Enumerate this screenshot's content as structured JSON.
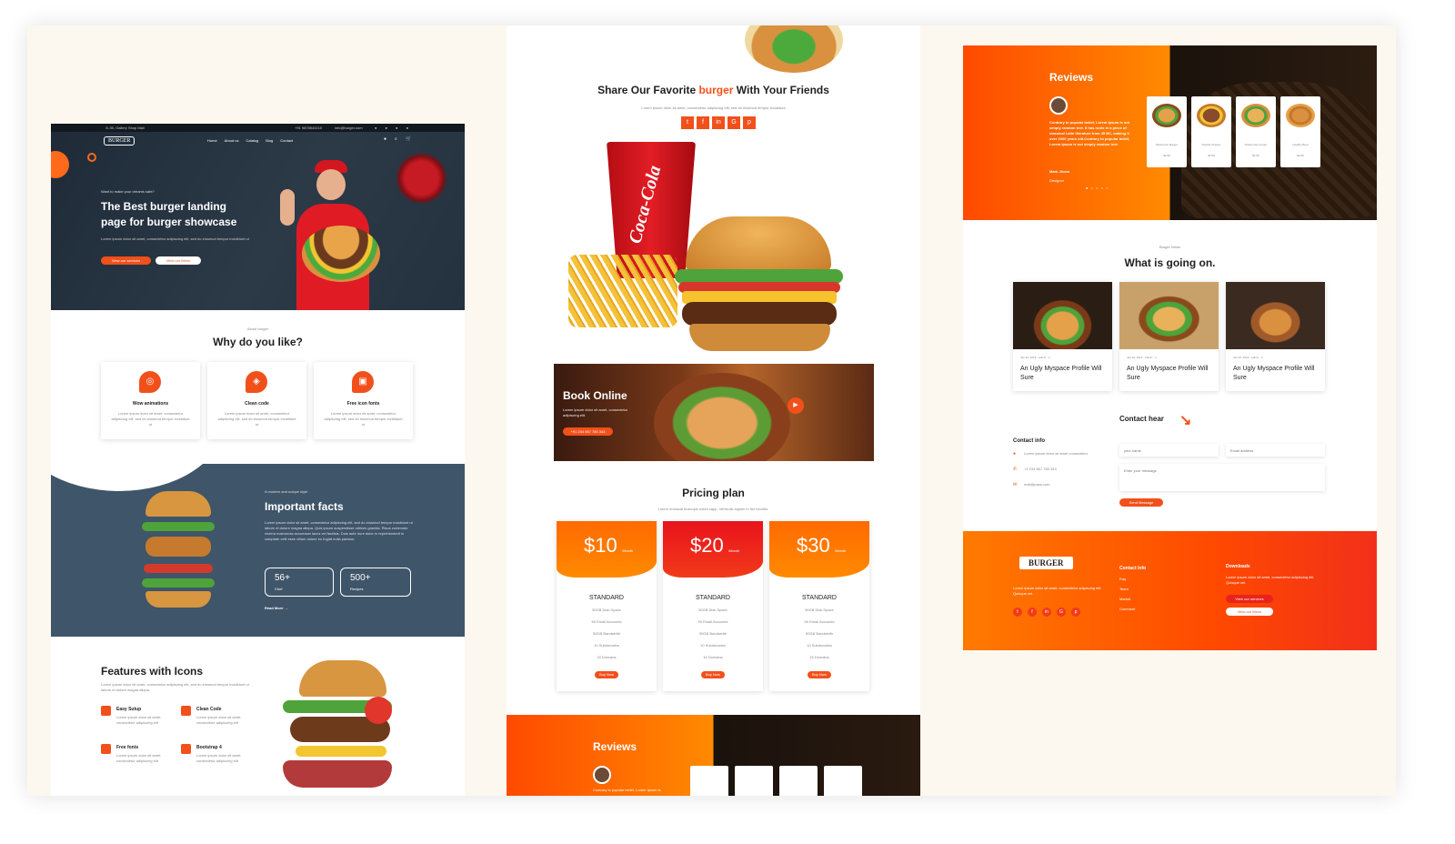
{
  "c1": {
    "topbar": {
      "address": "G-35, Gallery Shop Mall",
      "phone": "+91 9876543210",
      "email": "info@burger.com"
    },
    "logo": "BURGER",
    "nav": [
      "Home",
      "About us",
      "Catalog",
      "Blog",
      "Contact"
    ],
    "hero": {
      "eyebrow": "Want to make your dreams safe?",
      "title_line1": "The Best burger landing",
      "title_line2": "page for burger showcase",
      "text": "Lorem ipsum dolor sit amet, consectetur adipiscing elit, sed do eiusmod tempor incididunt ut",
      "btn1": "View our services",
      "btn2": "View our Menu"
    },
    "why": {
      "eyebrow": "About burger",
      "title": "Why do you like?",
      "cards": [
        {
          "title": "Wow animations",
          "text": "Lorem ipsum dolor sit amet, consectetur adipiscing elit, sed do eiusmod tempor incididunt ut"
        },
        {
          "title": "Clean code",
          "text": "Lorem ipsum dolor sit amet, consectetur adipiscing elit, sed do eiusmod tempor incididunt ut"
        },
        {
          "title": "Free icon fonts",
          "text": "Lorem ipsum dolor sit amet, consectetur adipiscing elit, sed do eiusmod tempor incididunt ut"
        }
      ]
    },
    "facts": {
      "eyebrow": "A modern and unique style",
      "title": "Important facts",
      "text": "Lorem ipsum dolor sit amet, consectetur adipiscing elit, sed do eiusmod tempor incididunt ut labore et dolore magna aliqua. Quis ipsum suspendisse ultrices gravida. Risus commodo viverra maecenas accumsan lacus vel facilisis. Duis aute irure dolor in reprehenderit in voluptate velit esse cillum dolore eu fugiat nulla pariatur.",
      "stat1_num": "56+",
      "stat1_label": "Chef",
      "stat2_num": "500+",
      "stat2_label": "Recipes",
      "read_more": "Read More →"
    },
    "features": {
      "title": "Features with Icons",
      "text": "Lorem ipsum dolor sit amet, consectetur adipiscing elit, sed do eiusmod tempor incididunt ut labore et dolore magna aliqua.",
      "items": [
        {
          "title": "Easy Sutup",
          "text": "Lorem ipsum dolor sit amet, consectetur adipiscing elit"
        },
        {
          "title": "Clean Code",
          "text": "Lorem ipsum dolor sit amet, consectetur adipiscing elit"
        },
        {
          "title": "Free fonts",
          "text": "Lorem ipsum dolor sit amet, consectetur adipiscing elit"
        },
        {
          "title": "Bootstrap 4",
          "text": "Lorem ipsum dolor sit amet, consectetur adipiscing elit"
        }
      ]
    }
  },
  "c2": {
    "share": {
      "pre": "Share Our Favorite ",
      "highlight": "burger",
      "post": " With Your Friends",
      "text": "Lorem ipsum dolor sit amet, consectetur adipiscing elit, sed do eiusmod tempor incididunt"
    },
    "cola_text": "Coca-Cola",
    "book": {
      "title": "Book Online",
      "text": "Lorem ipsum dolor sit amet, consectetur adipiscing elit.",
      "btn": "+91 234 567 780 343"
    },
    "pricing": {
      "title": "Pricing plan",
      "text": "Lorem recessal buscopis notes sapp. Vehiculis sapien in the lobortis.",
      "plans": [
        {
          "price": "$10",
          "period": "/Month",
          "name": "STANDARD",
          "features": [
            "50GB Disk Space",
            "50 Email Accounts",
            "50GB Bandwidth",
            "10 Subdomains",
            "15 Domains"
          ],
          "btn": "Buy Now"
        },
        {
          "price": "$20",
          "period": "/Month",
          "name": "STANDARD",
          "features": [
            "50GB Disk Space",
            "50 Email Accounts",
            "50GB Bandwidth",
            "10 Subdomains",
            "15 Domains"
          ],
          "btn": "Buy Now"
        },
        {
          "price": "$30",
          "period": "/Month",
          "name": "STANDARD",
          "features": [
            "50GB Disk Space",
            "50 Email Accounts",
            "50GB Bandwidth",
            "10 Subdomains",
            "15 Domains"
          ],
          "btn": "Buy Now"
        }
      ]
    },
    "reviews": {
      "title": "Reviews",
      "text": "Contrary to popular belief, Lorem Ipsum is"
    }
  },
  "c3": {
    "reviews": {
      "title": "Reviews",
      "text": "Contrary to popular belief, Lorem Ipsum is not simply random text. It has roots in a piece of classical Latin literature from 45 BC, making it over 2000 years old.Contrary to popular belief, Lorem Ipsum is not simply random text.",
      "name": "Mark Jhons",
      "role": "Designer",
      "products": [
        {
          "name": "Mushroom Burger",
          "price": "$2.99"
        },
        {
          "name": "Double Cheese",
          "price": "$3.99"
        },
        {
          "name": "Potato fries burger",
          "price": "$1.99"
        },
        {
          "name": "Healthy Beef",
          "price": "$3.99"
        }
      ]
    },
    "news": {
      "eyebrow": "Burger News",
      "title": "What is going on.",
      "posts": [
        {
          "meta": "Jan 20, 2019  ·  Admin  ·  2",
          "title": "An Ugly Myspace Profile Will Sure"
        },
        {
          "meta": "Jan 20, 2019  ·  Admin  ·  2",
          "title": "An Ugly Myspace Profile Will Sure"
        },
        {
          "meta": "Jan 20, 2019  ·  Admin  ·  2",
          "title": "An Ugly Myspace Profile Will Sure"
        }
      ]
    },
    "contact": {
      "title": "Contact hear",
      "info_title": "Contact info",
      "address": "Lorem ipsum dolor sit amet consectetur",
      "phone": "+1 234 567 780 343",
      "email": "mail@pass.com",
      "name_ph": "your name",
      "email_ph": "Email address",
      "msg_ph": "Enter your message",
      "send": "Send Message"
    },
    "footer": {
      "logo": "BURGER",
      "text": "Lorem ipsum dolor sit amet, consectetur adipiscing elit. Quisque vel.",
      "contact_title": "Contact Info",
      "links": [
        "Faq",
        "Team",
        "Market",
        "Comment"
      ],
      "downloads_title": "Downloads",
      "downloads_text": "Lorem ipsum dolor sit amet, consectetur adipiscing elit. Quisque vel.",
      "btn1": "View our services",
      "btn2": "View our Menu"
    }
  },
  "colors": {
    "accent": "#f2501b",
    "dark_blue": "#3f5569",
    "orange_light": "#ff8a00"
  }
}
